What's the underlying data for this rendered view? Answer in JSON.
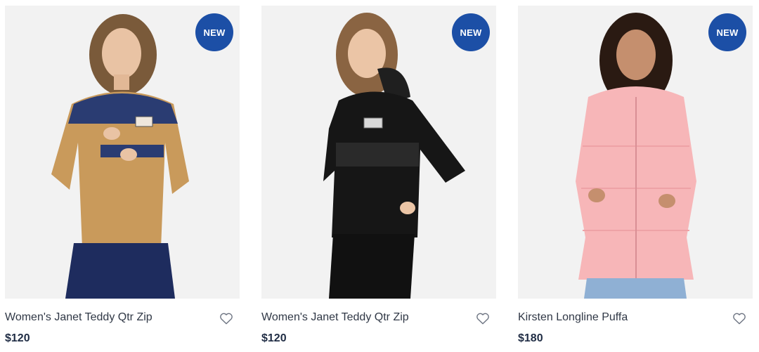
{
  "products": [
    {
      "name": "Women's Janet Teddy Qtr Zip",
      "price": "$120",
      "badge": "NEW",
      "image_alt": "Women's Janet Teddy Qtr Zip",
      "colors": {
        "top": "#c99a5b",
        "accent": "#2a3c72",
        "bottom": "#1e2c5e"
      }
    },
    {
      "name": "Women's Janet Teddy Qtr Zip",
      "price": "$120",
      "badge": "NEW",
      "image_alt": "Women's Janet Teddy Qtr Zip",
      "colors": {
        "top": "#161616",
        "accent": "#2a2a2a",
        "bottom": "#111111"
      }
    },
    {
      "name": "Kirsten Longline Puffa",
      "price": "$180",
      "badge": "NEW",
      "image_alt": "Kirsten Longline Puffa",
      "colors": {
        "top": "#f7b6b8",
        "accent": "#eea2a6",
        "bottom": "#8fb0d4"
      }
    }
  ],
  "theme": {
    "badge_color": "#1c4fa6",
    "price_color": "#1f2c44",
    "image_bg": "#f2f2f2"
  },
  "icons": {
    "wishlist": "heart-outline-icon"
  }
}
